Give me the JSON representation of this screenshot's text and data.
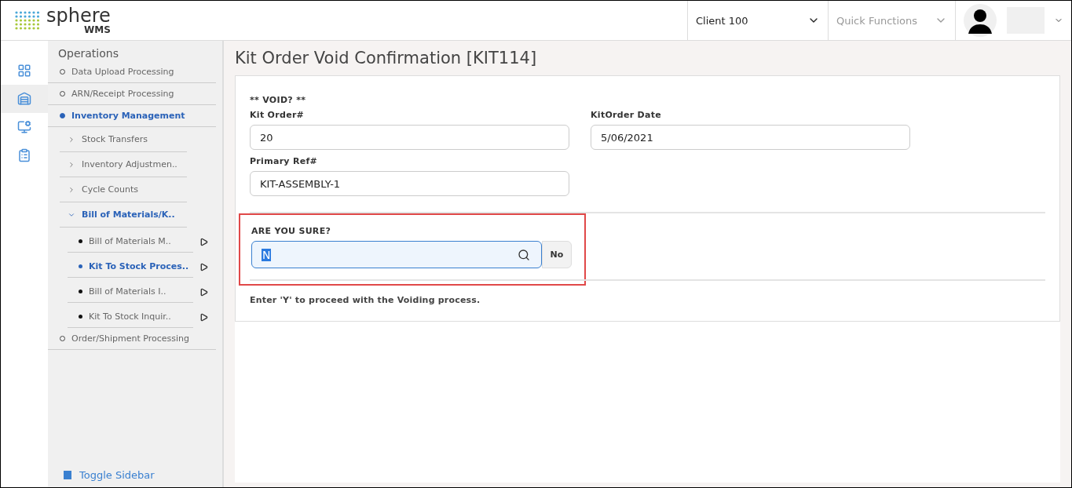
{
  "header": {
    "logo": {
      "name": "sphere",
      "sub": "WMS"
    },
    "client": "Client 100",
    "quick_functions": {
      "placeholder": "Quick Functions"
    }
  },
  "rail": [
    {
      "selected": false
    },
    {
      "selected": true
    },
    {
      "selected": false
    },
    {
      "selected": false
    }
  ],
  "sidebar": {
    "title": "Operations",
    "items": [
      {
        "label": "Data Upload Processing",
        "selected": false
      },
      {
        "label": "ARN/Receipt Processing",
        "selected": false
      },
      {
        "label": "Inventory Management",
        "selected": true,
        "children": [
          {
            "label": "Stock Transfers",
            "expanded": false
          },
          {
            "label": "Inventory Adjustmen..",
            "expanded": false
          },
          {
            "label": "Cycle Counts",
            "expanded": false
          },
          {
            "label": "Bill of Materials/K..",
            "expanded": true,
            "children": [
              {
                "label": "Bill of Materials M..",
                "selected": false
              },
              {
                "label": "Kit To Stock Proces..",
                "selected": true
              },
              {
                "label": "Bill of Materials I..",
                "selected": false
              },
              {
                "label": "Kit To Stock Inquir..",
                "selected": false
              }
            ]
          }
        ]
      },
      {
        "label": "Order/Shipment Processing",
        "selected": false
      }
    ],
    "toggle": "Toggle Sidebar"
  },
  "page": {
    "title": "Kit Order Void Confirmation [KIT114]",
    "heading": "** VOID? **",
    "fields": [
      {
        "label": "Kit Order#",
        "value": "20"
      },
      {
        "label": "KitOrder Date",
        "value": "5/06/2021"
      },
      {
        "label": "Primary Ref#",
        "value": "KIT-ASSEMBLY-1"
      }
    ],
    "confirm": {
      "label": "ARE YOU SURE?",
      "value": "N",
      "description": "No",
      "highlighted": true
    },
    "help": "Enter 'Y' to proceed with the Voiding process."
  }
}
